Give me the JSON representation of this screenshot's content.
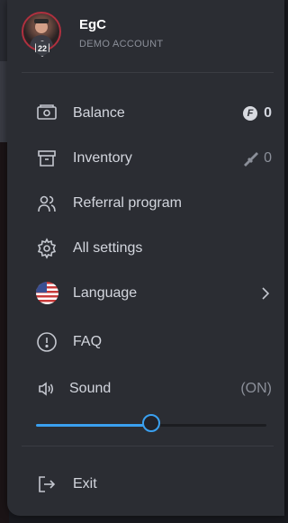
{
  "profile": {
    "username": "EgC",
    "account_type": "DEMO ACCOUNT",
    "level": "22",
    "avatar_icon": "user-avatar",
    "badge_color": "#b0303f"
  },
  "menu": {
    "balance": {
      "label": "Balance",
      "value": "0",
      "icon": "wallet-icon",
      "currency_symbol": "F"
    },
    "inventory": {
      "label": "Inventory",
      "value": "0",
      "icon": "archive-box-icon",
      "value_icon": "rifle-icon"
    },
    "referral": {
      "label": "Referral program",
      "icon": "users-icon"
    },
    "settings": {
      "label": "All settings",
      "icon": "gear-icon"
    },
    "language": {
      "label": "Language",
      "icon": "us-flag-icon"
    },
    "faq": {
      "label": "FAQ",
      "icon": "info-circle-icon"
    },
    "sound": {
      "label": "Sound",
      "status": "(ON)",
      "icon": "speaker-icon",
      "volume": 0.5
    },
    "exit": {
      "label": "Exit",
      "icon": "logout-icon"
    }
  },
  "colors": {
    "accent": "#3aa0f0",
    "panel": "#2b2d33",
    "text": "#d3d6de",
    "muted": "#8b8f99"
  }
}
